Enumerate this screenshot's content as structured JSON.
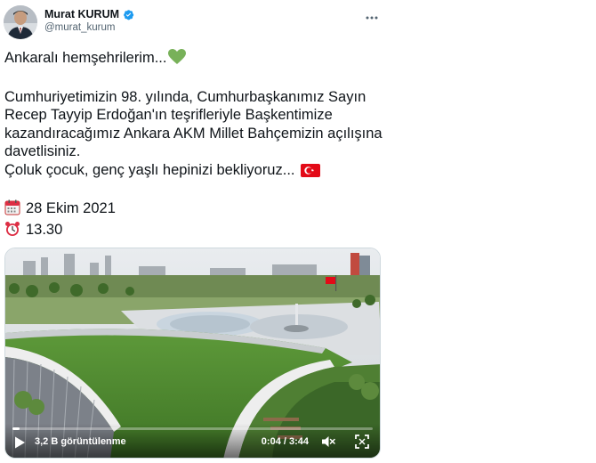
{
  "author": {
    "display_name": "Murat KURUM",
    "handle": "@murat_kurum",
    "verified": true
  },
  "tweet": {
    "line1": "Ankaralı hemşehrilerim...",
    "line1_emoji": "green-heart-icon",
    "paragraph": "Cumhuriyetimizin 98. yılında, Cumhurbaşkanımız Sayın Recep Tayyip Erdoğan'ın teşrifleriyle Başkentimize kazandıracağımız Ankara AKM Millet Bahçemizin açılışına davetlisiniz.",
    "line_invite": "Çoluk çocuk, genç yaşlı hepinizi bekliyoruz...",
    "invite_emoji": "turkey-flag-icon",
    "date": "28 Ekim 2021",
    "date_icon": "calendar-icon",
    "time": "13.30",
    "time_icon": "alarm-clock-icon"
  },
  "video": {
    "views": "3,2 B görüntülenme",
    "timestamp": "0:04 / 3:44",
    "progress_fraction": 0.02
  },
  "colors": {
    "text": "#0f1419",
    "muted": "#536471",
    "verified": "#1d9bf0",
    "heart": "#78b159",
    "flag": "#e30a17"
  }
}
